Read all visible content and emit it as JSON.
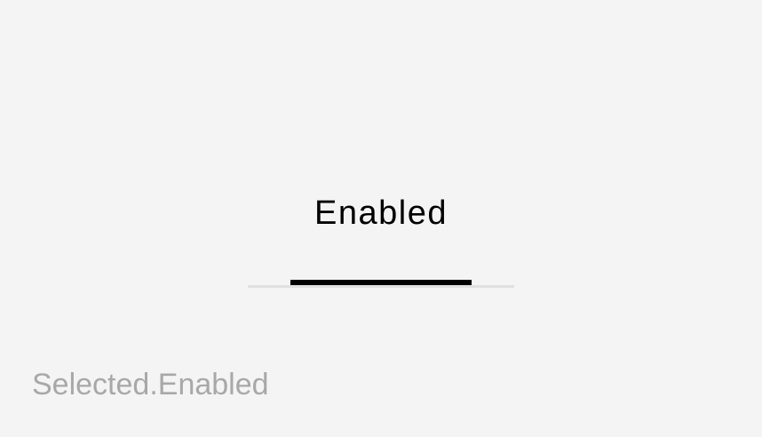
{
  "tab": {
    "label": "Enabled",
    "selected": true,
    "indicator_color": "#000000",
    "track_color": "#e0e0e0",
    "text_color": "#000000"
  },
  "caption": {
    "text": "Selected.Enabled",
    "color": "#a8a8a8"
  },
  "background_color": "#f4f4f4"
}
